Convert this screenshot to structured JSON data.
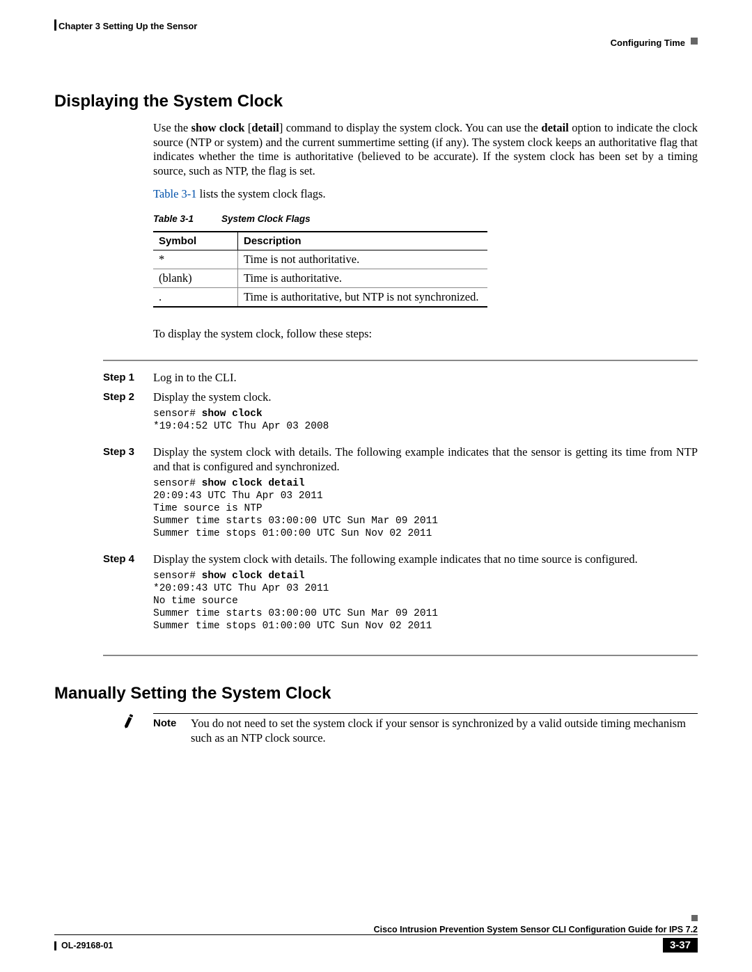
{
  "header": {
    "chapter": "Chapter 3      Setting Up the Sensor",
    "section": "Configuring Time"
  },
  "h1": "Displaying the System Clock",
  "intro_parts": {
    "p1a": "Use the ",
    "p1b": "show clock",
    "p1c": " [",
    "p1d": "detail",
    "p1e": "] command to display the system clock. You can use the ",
    "p1f": "detail",
    "p1g": " option to indicate the clock source (NTP or system) and the current summertime setting (if any). The system clock keeps an authoritative flag that indicates whether the time is authoritative (believed to be accurate). If the system clock has been set by a timing source, such as NTP, the flag is set."
  },
  "table_ref": {
    "link": "Table 3-1",
    "after": " lists the system clock flags."
  },
  "table": {
    "caption_num": "Table 3-1",
    "caption_title": "System Clock Flags",
    "head_sym": "Symbol",
    "head_desc": "Description",
    "rows": [
      {
        "sym": "*",
        "desc": "Time is not authoritative."
      },
      {
        "sym": "(blank)",
        "desc": "Time is authoritative."
      },
      {
        "sym": ".",
        "desc": "Time is authoritative, but NTP is not synchronized."
      }
    ]
  },
  "lead_in": "To display the system clock, follow these steps:",
  "steps": {
    "s1": {
      "label": "Step 1",
      "text": "Log in to the CLI."
    },
    "s2": {
      "label": "Step 2",
      "text": "Display the system clock.",
      "code_prompt": "sensor# ",
      "code_cmd": "show clock",
      "code_rest": "*19:04:52 UTC Thu Apr 03 2008"
    },
    "s3": {
      "label": "Step 3",
      "text": "Display the system clock with details. The following example indicates that the sensor is getting its time from NTP and that is configured and synchronized.",
      "code_prompt": "sensor# ",
      "code_cmd": "show clock detail",
      "code_rest": "20:09:43 UTC Thu Apr 03 2011\nTime source is NTP\nSummer time starts 03:00:00 UTC Sun Mar 09 2011\nSummer time stops 01:00:00 UTC Sun Nov 02 2011"
    },
    "s4": {
      "label": "Step 4",
      "text": "Display the system clock with details. The following example indicates that no time source is configured.",
      "code_prompt": "sensor# ",
      "code_cmd": "show clock detail",
      "code_rest": "*20:09:43 UTC Thu Apr 03 2011\nNo time source\nSummer time starts 03:00:00 UTC Sun Mar 09 2011\nSummer time stops 01:00:00 UTC Sun Nov 02 2011"
    }
  },
  "h2": "Manually Setting the System Clock",
  "note": {
    "label": "Note",
    "text": "You do not need to set the system clock if your sensor is synchronized by a valid outside timing mechanism such as an NTP clock source."
  },
  "footer": {
    "title": "Cisco Intrusion Prevention System Sensor CLI Configuration Guide for IPS 7.2",
    "doc": "OL-29168-01",
    "page": "3-37"
  }
}
